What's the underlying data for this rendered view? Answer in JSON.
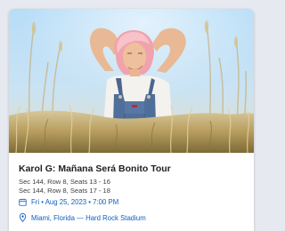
{
  "event": {
    "title": "Karol G: Mañana Será Bonito Tour",
    "seats": [
      "Sec 144, Row 8, Seats 13 - 16",
      "Sec 144, Row 8, Seats 17 - 18"
    ],
    "date": "Fri • Aug 25, 2023 • 7:00 PM",
    "location": "Miami, Florida — Hard Rock Stadium"
  },
  "icons": {
    "date": "calendar-icon",
    "location": "map-pin-icon"
  },
  "colors": {
    "link": "#0f5fc2",
    "title": "#1f1f1f",
    "sky": "#b8dbf6",
    "grass": "#b49a5a"
  }
}
